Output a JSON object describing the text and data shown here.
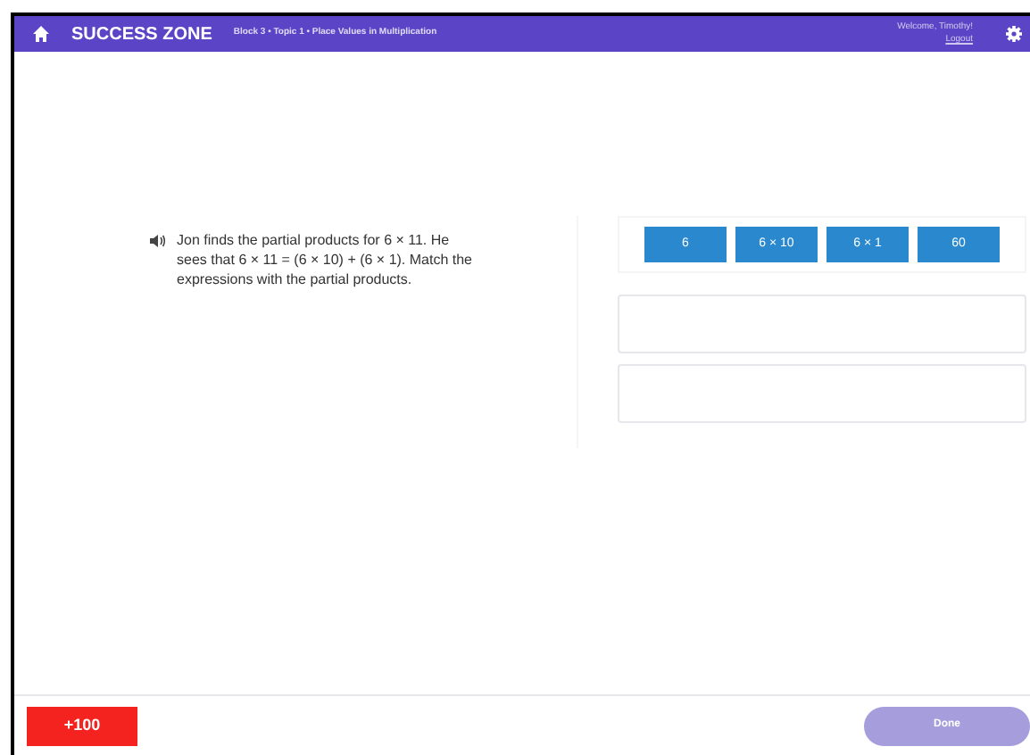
{
  "header": {
    "title": "SUCCESS ZONE",
    "breadcrumb": "Block 3 • Topic 1 • Place Values in Multiplication",
    "welcome": "Welcome, Timothy!",
    "logout": "Logout"
  },
  "question": {
    "text": "Jon finds the partial products for 6 × 11. He sees that 6 × 11 = (6 × 10) + (6 × 1). Match the expressions with the partial products."
  },
  "tiles": [
    "6",
    "6 × 10",
    "6 × 1",
    "60"
  ],
  "drop_zones": [
    {
      "kind": "empty"
    },
    {
      "kind": "empty"
    }
  ],
  "footer": {
    "points": "+100",
    "done": {
      "label": "Done",
      "disabled": true
    }
  }
}
